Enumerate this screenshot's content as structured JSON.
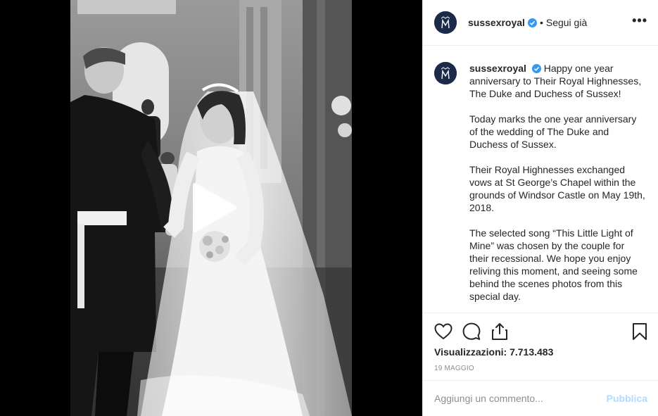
{
  "post": {
    "username": "sussexroyal",
    "header_separator": "•",
    "follow_label": "Segui già",
    "more_icon": "more-horizontal-icon",
    "caption_lead": "Happy one year anniversary to Their Royal Highnesses, The Duke and Duchess of Sussex!",
    "caption_paragraphs": [
      "Today marks the one year anniversary of the wedding of The Duke and Duchess of Sussex.",
      "Their Royal Highnesses exchanged vows at St George’s Chapel within the grounds of Windsor Castle on May 19th, 2018.",
      "The selected song “This Little Light of Mine” was chosen by the couple for their recessional. We hope you enjoy reliving this moment, and seeing some behind the scenes photos from this special day."
    ],
    "views": "Visualizzazioni: 7.713.483",
    "date": "19 MAGGIO"
  },
  "comment_box": {
    "placeholder": "Aggiungi un commento...",
    "publish_label": "Pubblica"
  },
  "colors": {
    "verified": "#3897f0",
    "publish_disabled": "#b3dbff",
    "avatar_bg": "#1c2a4a"
  }
}
